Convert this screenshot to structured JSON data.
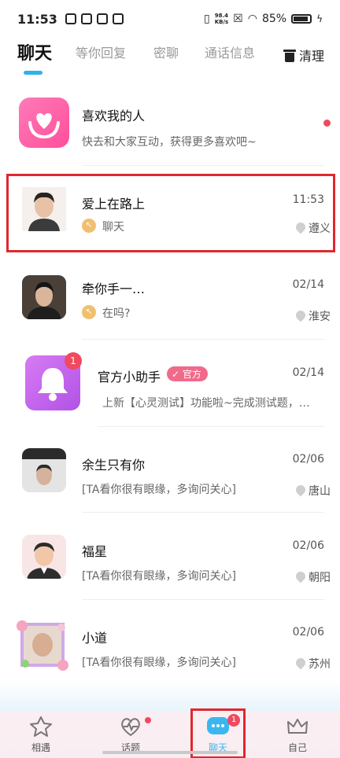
{
  "status_bar": {
    "time": "11:53",
    "net_speed_top": "98.4",
    "net_speed_bottom": "KB/s",
    "battery": "85%"
  },
  "tabs": [
    "聊天",
    "等你回复",
    "密聊",
    "通话信息"
  ],
  "clean_label": "清理",
  "likes_row": {
    "title": "喜欢我的人",
    "subtitle": "快去和大家互动，获得更多喜欢吧~"
  },
  "conversations": [
    {
      "name": "爱上在路上",
      "message": "聊天",
      "time": "11:53",
      "location": "遵义"
    },
    {
      "name": "牵你手一…",
      "message": "在吗?",
      "time": "02/14",
      "location": "淮安"
    },
    {
      "name": "官方小助手",
      "badge": "官方",
      "message": "上新【心灵测试】功能啦~完成测试题，就…",
      "time": "02/14",
      "unread": "1"
    },
    {
      "name": "余生只有你",
      "message": "[TA看你很有眼缘，多询问关心]",
      "time": "02/06",
      "location": "唐山"
    },
    {
      "name": "福星",
      "message": "[TA看你很有眼缘，多询问关心]",
      "time": "02/06",
      "location": "朝阳"
    },
    {
      "name": "小道",
      "message": "[TA看你很有眼缘，多询问关心]",
      "time": "02/06",
      "location": "苏州"
    }
  ],
  "bottom_nav": [
    {
      "label": "相遇",
      "icon": "star-icon"
    },
    {
      "label": "话题",
      "icon": "heart-pulse-icon"
    },
    {
      "label": "聊天",
      "icon": "chat-bubble-icon",
      "badge": "1"
    },
    {
      "label": "自己",
      "icon": "crown-icon"
    }
  ],
  "colors": {
    "accent": "#2bb3ea",
    "badge_red": "#f04a5e",
    "highlight": "#e0272f"
  }
}
